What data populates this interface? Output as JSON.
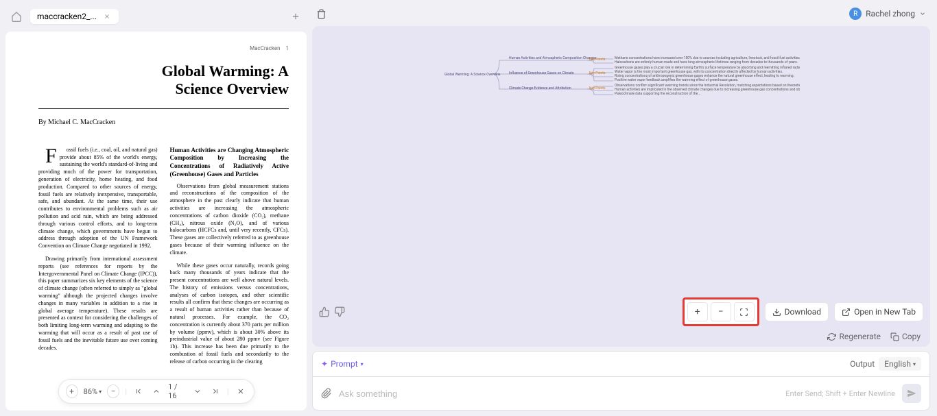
{
  "tab": {
    "name": "maccracken2_..."
  },
  "pdf": {
    "header_name": "MacCracken",
    "header_page": "1",
    "title": "Global Warming: A Science Overview",
    "author": "By Michael C. MacCracken",
    "col1_p1": "Fossil fuels (i.e., coal, oil, and natural gas) provide about 85% of the world's energy, sustaining the world's standard-of-living and providing much of the power for transportation, generation of electricity, home heating, and food production. Compared to other sources of energy, fossil fuels are relatively inexpensive, transportable, safe, and abundant. At the same time, their use contributes to environmental problems such as air pollution and acid rain, which are being addressed through various control efforts, and to long-term climate change, which governments have begun to address through adoption of the UN Framework Convention on Climate Change negotiated in 1992.",
    "col1_p2": "Drawing primarily from international assessment reports (see references for reports by the Intergovernmental Panel on Climate Change (IPCC)), this paper summarizes six key elements of the science of climate change (often referred to simply as \"global warming\" although the projected changes involve changes in many variables in addition to a rise in global average temperature). These results are presented as context for considering the challenges of both limiting long-term warming and adapting to the warming that will occur as a result of past use of fossil fuels and the inevitable future use over coming decades.",
    "col2_h": "Human Activities are Changing Atmospheric Composition by Increasing the Concentrations of Radiatively Active (Greenhouse) Gases and Particles",
    "col2_p1": "Observations from global measurement stations and reconstructions of the composition of the atmosphere in the past clearly indicate that human activities are increasing the atmospheric concentrations of carbon dioxide (CO₂), methane (CH₄), nitrous oxide (N₂O), and of various halocarbons (HCFCs and, until very recently, CFCs). These gases are collectively referred to as greenhouse gases because of their warming influence on the climate.",
    "col2_p2": "While these gases occur naturally, records going back many thousands of years indicate that the present concentrations are well above natural levels. The history of emissions versus concentrations, analyses of carbon isotopes, and other scientific results all confirm that these changes are occurring as a result of human activities rather than because of natural processes. For example, the CO₂ concentration is currently about 370 parts per million by volume (ppmv), which is about 30% above its preindustrial value of about 280 ppmv (see Figure 1b). This increase has been due primarily to the combustion of fossil fuels and secondarily to the release of carbon occurring in the clearing"
  },
  "toolbar": {
    "zoom": "86%",
    "page_current": "1",
    "page_total": "16"
  },
  "user": {
    "initial": "R",
    "name": "Rachel zhong"
  },
  "mindmap": {
    "root": "Global Warming: A Science Overview",
    "n1": "Human Activities and Atmospheric Composition Changes",
    "n2": "Influence of Greenhouse Gases on Climate",
    "n3": "Climate Change Evidence and Attribution",
    "kp": "Key Points",
    "l1": "Methane concentrations have increased over 150% due to sources including agriculture, livestock, and fossil fuel activities.",
    "l2": "Halocarbons are entirely human-made and have long atmospheric lifetimes ranging from decades to thousands of years.",
    "l3": "Greenhouse gases play a crucial role in determining Earth's surface temperature by absorbing and reemitting infrared radiation.",
    "l4": "Water vapor is the most important greenhouse gas, with its concentration directly affected by human activities.",
    "l5": "Rising concentrations of anthropogenic greenhouse gases enhance the natural greenhouse effect, leading to warming.",
    "l6": "Positive water vapor feedback amplifies the warming effect of greenhouse gases.",
    "l7": "Observations confirm significant warming trends since the Industrial Revolution, matching expectations based on theoretical analyses.",
    "l8": "Human activities are implicated in the observed climate changes due to increasing greenhouse gas concentrations and observed warming magnitudes.",
    "l9": "Paleoclimate data supporting the reconstruction of the..."
  },
  "actions": {
    "download": "Download",
    "opentab": "Open in New Tab",
    "regenerate": "Regenerate",
    "copy": "Copy"
  },
  "prompt": {
    "label": "Prompt",
    "output": "Output",
    "language": "English",
    "placeholder": "Ask something",
    "hint": "Enter Send; Shift + Enter Newline"
  }
}
